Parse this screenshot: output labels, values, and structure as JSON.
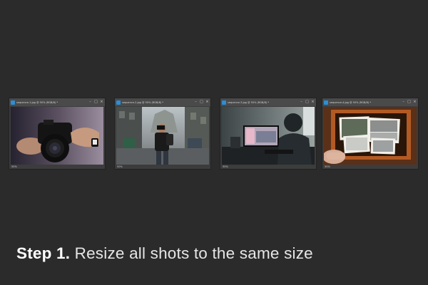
{
  "windows": [
    {
      "title": "sequence-1.jpg @ 50% (RGB/8) *",
      "zoom": "50%",
      "image": "photographer-holding-camera-photo"
    },
    {
      "title": "sequence-2.jpg @ 50% (RGB/8) *",
      "zoom": "50%",
      "image": "street-photographer-photo"
    },
    {
      "title": "sequence-3.jpg @ 50% (RGB/8) *",
      "zoom": "50%",
      "image": "person-at-computer-photo"
    },
    {
      "title": "sequence-4.jpg @ 50% (RGB/8) *",
      "zoom": "50%",
      "image": "photos-in-frame-photo"
    }
  ],
  "window_controls": {
    "minimize": "–",
    "restore": "□",
    "close": "×"
  },
  "caption": {
    "step": "Step 1.",
    "text": "Resize all shots to the same size"
  },
  "colors": {
    "background": "#2b2b2b",
    "window": "#3c3c3c",
    "titlebar": "#4a4a4a",
    "app_icon": "#2a8fd6",
    "caption": "#ffffff"
  }
}
